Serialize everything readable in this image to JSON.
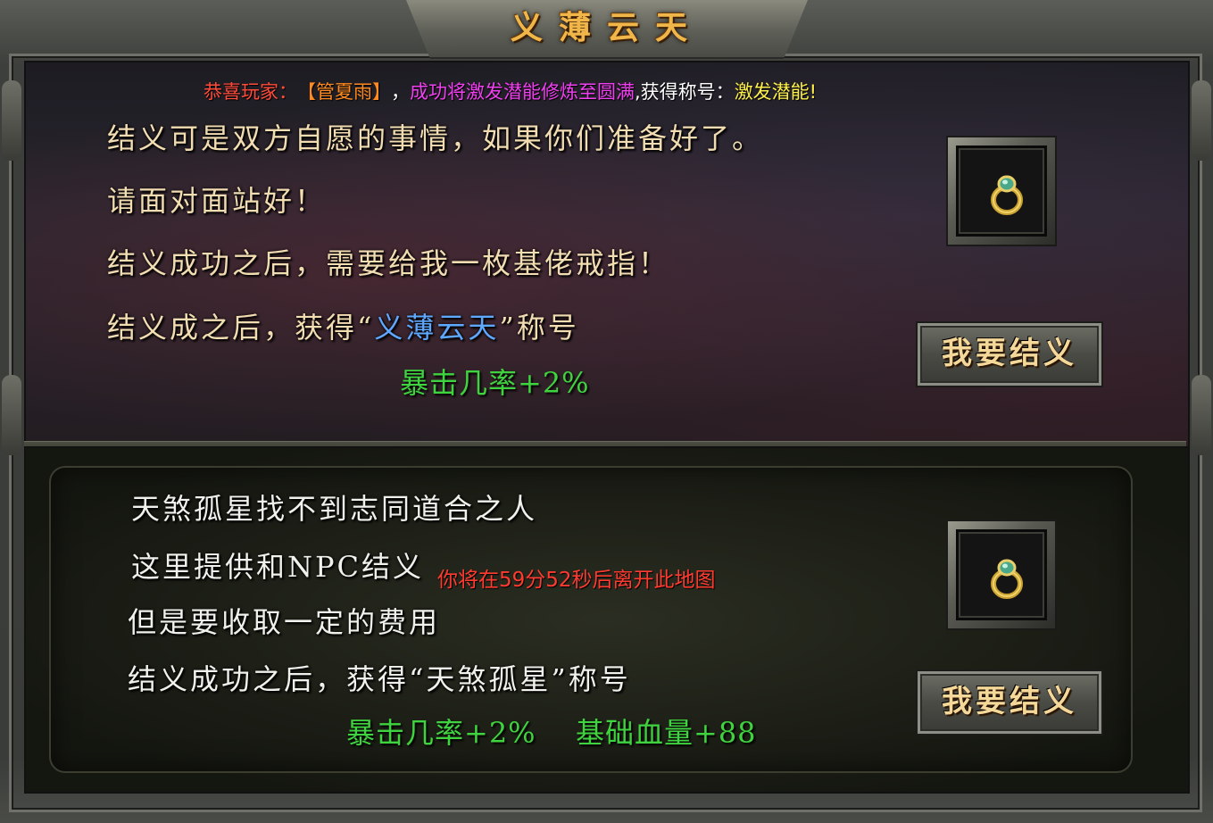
{
  "title": "义薄云天",
  "announcement": {
    "prefix": "恭喜玩家：",
    "player": "【管夏雨】",
    "comma": "，",
    "achievement": "成功将激发潜能修炼至圆满",
    "gained": ",获得称号：",
    "honor": "激发潜能!"
  },
  "top_section": {
    "line1": "结义可是双方自愿的事情，如果你们准备好了。",
    "line2": "请面对面站好！",
    "line3": "结义成功之后，需要给我一枚基佬戒指！",
    "line4_pre": "结义成之后，获得“",
    "line4_title": "义薄云天",
    "line4_post": "”称号",
    "bonus": "暴击几率+2%",
    "item_icon": "ring-icon",
    "button_label": "我要结义"
  },
  "bottom_section": {
    "line1": "天煞孤星找不到志同道合之人",
    "line2": "这里提供和NPC结义",
    "line3": "但是要收取一定的费用",
    "line4": "结义成功之后，获得“天煞孤星”称号",
    "bonus1": "暴击几率+2%",
    "bonus2": "基础血量+88",
    "item_icon": "ring-icon",
    "button_label": "我要结义"
  },
  "countdown": "你将在59分52秒后离开此地图",
  "colors": {
    "title": "#f0b64a",
    "body_text": "#f2ddb2",
    "highlight_blue": "#5fa8ff",
    "bonus_green": "#3fd33f",
    "warning_red": "#ff3b30"
  }
}
